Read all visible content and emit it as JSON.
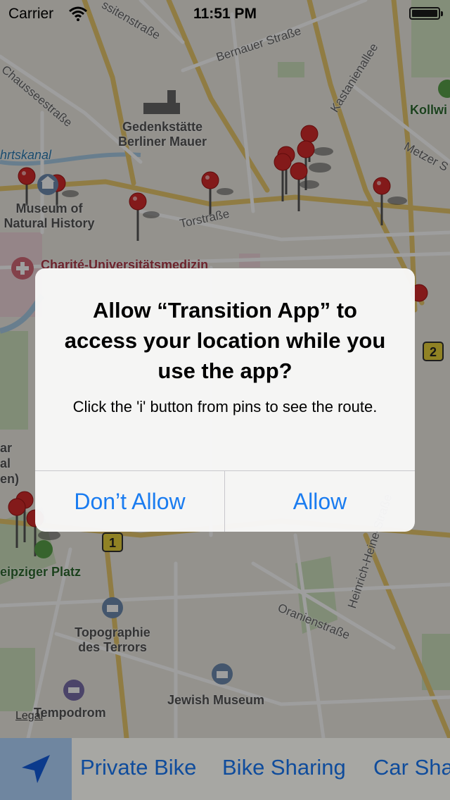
{
  "status_bar": {
    "carrier": "Carrier",
    "time": "11:51 PM"
  },
  "map": {
    "labels": {
      "bernauer": "Bernauer Straße",
      "ssitenstrasse": "ssitenstraße",
      "kastanienallee": "Kastanienallee",
      "chausseestrasse": "Chausseestraße",
      "gedenkstaette_1": "Gedenkstätte",
      "gedenkstaette_2": "Berliner Mauer",
      "kollwi": "Kollwi",
      "metzer": "Metzer S",
      "hrtskanal": "hrtskanal",
      "museum_1": "Museum of",
      "museum_2": "Natural History",
      "torstrasse": "Torstraße",
      "charite": "Charité-Universitätsmedizin",
      "ar": "ar",
      "al": "al",
      "en": "en)",
      "leipziger": "eipziger Platz",
      "topographie_1": "Topographie",
      "topographie_2": "des Terrors",
      "oranienstrasse": "Oranienstraße",
      "heinrich": "Heinrich-Heine-Straße",
      "jewish_museum": "Jewish Museum",
      "tempodrom": "Tempodrom",
      "legal": "Legal",
      "badge_1": "1",
      "badge_2": "2"
    }
  },
  "alert": {
    "title": "Allow “Transition App” to access your location while you use the app?",
    "message": "Click the 'i' button from pins to see the route.",
    "dont_allow": "Don’t Allow",
    "allow": "Allow"
  },
  "tab_bar": {
    "items": [
      "Private Bike",
      "Bike Sharing",
      "Car Sha"
    ]
  },
  "colors": {
    "alert_button": "#1a7cf0",
    "tab_text": "#0f4c9c",
    "locate_button_bg": "#6f86a0",
    "pin_red": "#d42a2a"
  },
  "icons": {
    "locate": "location-arrow-icon",
    "wifi": "wifi-icon",
    "battery": "battery-icon",
    "pin": "map-pin-icon",
    "museum": "museum-icon",
    "hospital": "hospital-icon",
    "memorial": "memorial-icon"
  }
}
